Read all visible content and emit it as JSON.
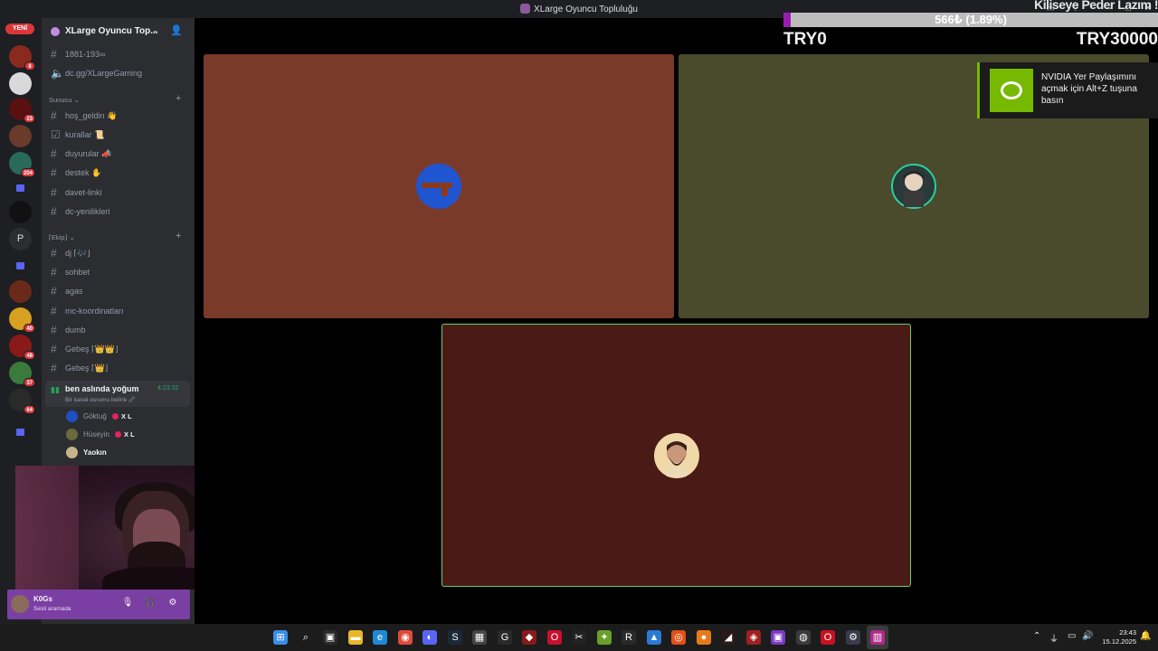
{
  "window": {
    "title": "XLarge Oyuncu Topluluğu",
    "minimize": "–",
    "maximize": "□",
    "close": "✕",
    "inbox": "▭",
    "help": "?"
  },
  "rail": {
    "new_badge": "YENİ",
    "servers": [
      {
        "name": "server-1",
        "color": "#8a2a1e",
        "badge": "8"
      },
      {
        "name": "server-2",
        "color": "#d9d9d9",
        "badge": ""
      },
      {
        "name": "server-3",
        "color": "#5a1010",
        "badge": "23"
      },
      {
        "name": "server-4",
        "color": "#6a3a2a",
        "badge": ""
      },
      {
        "name": "server-5",
        "color": "#2a6a5a",
        "badge": "204"
      },
      {
        "name": "folder-1",
        "color": "folder",
        "badge": ""
      },
      {
        "name": "server-6",
        "color": "#111111",
        "badge": ""
      },
      {
        "name": "server-p",
        "color": "letter",
        "letter": "P",
        "badge": ""
      },
      {
        "name": "folder-2",
        "color": "folder",
        "badge": ""
      },
      {
        "name": "server-7",
        "color": "#6a2a1a",
        "badge": ""
      },
      {
        "name": "server-8",
        "color": "#d8a020",
        "badge": "40"
      },
      {
        "name": "server-9",
        "color": "#8a1a1a",
        "badge": "48"
      },
      {
        "name": "server-10",
        "color": "#3a7a3a",
        "badge": "37"
      },
      {
        "name": "server-11",
        "color": "#2a2a2a",
        "badge": "64"
      },
      {
        "name": "folder-3",
        "color": "folder",
        "badge": ""
      }
    ]
  },
  "sidebar": {
    "server_name": "XLarge Oyuncu Top...",
    "channels_top": [
      {
        "label": "1881-193∞"
      },
      {
        "label": "dc.gg/XLargeGaming"
      }
    ],
    "category_sunucu": "Sunucu ⌄",
    "channels_sunucu": [
      {
        "label": "hoş_geldin 👋"
      },
      {
        "label": "kurallar 📜"
      },
      {
        "label": "duyurular 📣"
      },
      {
        "label": "destek ✋"
      },
      {
        "label": "davet-linki"
      },
      {
        "label": "dc-yenilikleri"
      }
    ],
    "category_ekip": "⌈Ekip⌋ ⌄",
    "channels_ekip": [
      {
        "label": "dj ⌈🎶⌋"
      },
      {
        "label": "sohbet"
      },
      {
        "label": "agas"
      },
      {
        "label": "mc-koordinatları"
      },
      {
        "label": "dumb"
      },
      {
        "label": "Gebeş ⌈👑👑⌋"
      },
      {
        "label": "Gebeş ⌈👑⌋"
      }
    ],
    "voice_channel": {
      "name": "ben aslında yoğum",
      "time": "4:23:32",
      "status": "Bir kanal durumu belirle 🖉"
    },
    "voice_users": [
      {
        "name": "Göktuğ",
        "tag": "X L",
        "avatar_color": "#1f4fc0"
      },
      {
        "name": "Hüseyin",
        "tag": "X L",
        "avatar_color": "#6a6a3a"
      },
      {
        "name": "Yaokın",
        "tag": "",
        "avatar_color": "#c8b48a"
      }
    ]
  },
  "user_panel": {
    "name": "K0Gs",
    "status": "Sesli aramada",
    "mic_icon": "🎙",
    "headphone_icon": "🎧",
    "settings_icon": "⚙"
  },
  "stage": {
    "tiles": [
      {
        "name": "tile-goktug",
        "bg": "#7a3a2a",
        "avatar_color": "#1f55d0"
      },
      {
        "name": "tile-huseyin",
        "bg": "#4a4a2c",
        "avatar_color": "#2a3a3a"
      },
      {
        "name": "tile-yakin",
        "bg": "#4a1a16",
        "avatar_color": "#f0d8a8"
      }
    ]
  },
  "goal": {
    "title": "Kiliseye Peder Lazım !",
    "amount": "566₺ (1.89%)",
    "min": "TRY0",
    "max": "TRY30000",
    "progress": 0.0189
  },
  "nvidia": {
    "message": "NVIDIA Yer Paylaşımını açmak için Alt+Z tuşuna basın"
  },
  "taskbar": {
    "time": "23:43",
    "date": "15.12.2025",
    "tray_chevron": "⌃",
    "apps": [
      {
        "name": "start",
        "color": "#3a8ee6",
        "glyph": "⊞"
      },
      {
        "name": "search",
        "color": "#1c1c1c",
        "glyph": "⌕"
      },
      {
        "name": "task-view",
        "color": "#2a2a2a",
        "glyph": "▣"
      },
      {
        "name": "file-explorer",
        "color": "#e8b62a",
        "glyph": "▬"
      },
      {
        "name": "edge",
        "color": "#1e8ad6",
        "glyph": "e"
      },
      {
        "name": "chrome",
        "color": "#e04a3a",
        "glyph": "◉"
      },
      {
        "name": "discord",
        "color": "#5865f2",
        "glyph": "◐"
      },
      {
        "name": "steam",
        "color": "#1b2838",
        "glyph": "S"
      },
      {
        "name": "app-qr",
        "color": "#444444",
        "glyph": "▦"
      },
      {
        "name": "app-g",
        "color": "#2a2a2a",
        "glyph": "G"
      },
      {
        "name": "app-red",
        "color": "#8a1a1a",
        "glyph": "◆"
      },
      {
        "name": "app-opera",
        "color": "#c8102e",
        "glyph": "O"
      },
      {
        "name": "app-capcut",
        "color": "#222222",
        "glyph": "✂"
      },
      {
        "name": "app-green",
        "color": "#6aa02a",
        "glyph": "✦"
      },
      {
        "name": "app-r",
        "color": "#2a2a2a",
        "glyph": "R"
      },
      {
        "name": "app-blue",
        "color": "#2a7ad6",
        "glyph": "▲"
      },
      {
        "name": "app-orange",
        "color": "#e0501a",
        "glyph": "◎"
      },
      {
        "name": "firefox",
        "color": "#e87a1a",
        "glyph": "●"
      },
      {
        "name": "app-dark",
        "color": "#2a1a1a",
        "glyph": "◢"
      },
      {
        "name": "app-shield",
        "color": "#a02020",
        "glyph": "◈"
      },
      {
        "name": "app-purple",
        "color": "#7a3ac0",
        "glyph": "▣"
      },
      {
        "name": "app-obs",
        "color": "#3a3a3a",
        "glyph": "◍"
      },
      {
        "name": "app-opera-gx",
        "color": "#c81020",
        "glyph": "O"
      },
      {
        "name": "settings",
        "color": "#3a3a4a",
        "glyph": "⚙"
      },
      {
        "name": "app-active",
        "color": "#b02a8a",
        "glyph": "▥"
      }
    ]
  }
}
